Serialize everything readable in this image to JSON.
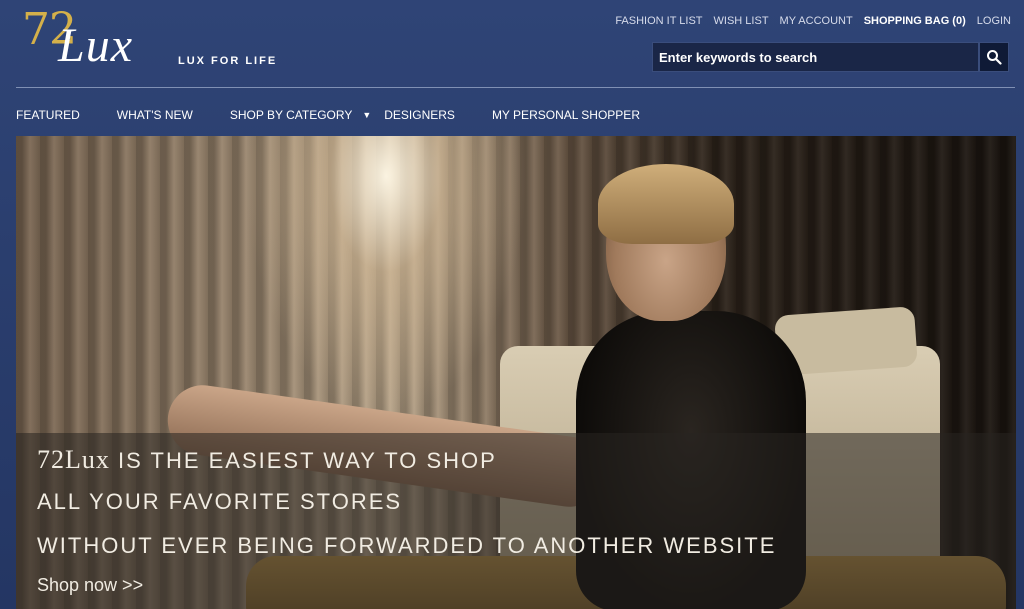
{
  "logo": {
    "number": "72",
    "word": "Lux"
  },
  "tagline": "LUX FOR LIFE",
  "utility_nav": [
    {
      "label": "FASHION IT LIST"
    },
    {
      "label": "WISH LIST"
    },
    {
      "label": "MY ACCOUNT"
    },
    {
      "label": "SHOPPING BAG (0)"
    },
    {
      "label": "LOGIN"
    }
  ],
  "search": {
    "placeholder": "Enter keywords to search",
    "icon": "search-icon"
  },
  "main_nav": [
    {
      "label": "FEATURED"
    },
    {
      "label": "WHAT'S NEW"
    },
    {
      "label": "SHOP BY CATEGORY"
    },
    {
      "label": "DESIGNERS"
    },
    {
      "label": "MY PERSONAL SHOPPER"
    }
  ],
  "hero": {
    "brand": "72Lux",
    "line1_rest": " IS THE EASIEST WAY TO SHOP",
    "line2": "ALL YOUR FAVORITE STORES",
    "line3": "WITHOUT EVER BEING FORWARDED TO ANOTHER WEBSITE",
    "cta": "Shop now >>"
  },
  "colors": {
    "background": "#2f4476",
    "accent": "#d4b04a"
  }
}
